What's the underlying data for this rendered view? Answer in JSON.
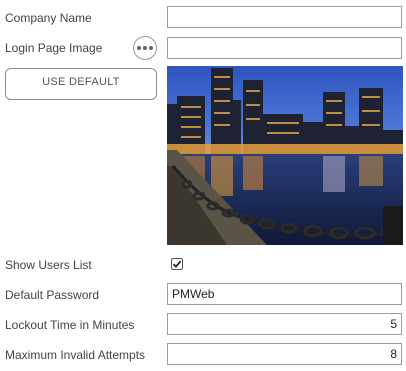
{
  "fields": {
    "company_name": {
      "label": "Company Name",
      "value": ""
    },
    "login_page_image": {
      "label": "Login Page Image",
      "value": ""
    },
    "show_users_list": {
      "label": "Show Users List",
      "checked": true
    },
    "default_password": {
      "label": "Default Password",
      "value": "PMWeb"
    },
    "lockout_time": {
      "label": "Lockout Time in Minutes",
      "value": "5"
    },
    "max_invalid_attempts": {
      "label": "Maximum Invalid Attempts",
      "value": "8"
    }
  },
  "buttons": {
    "use_default": "USE DEFAULT",
    "browse_icon": "more-horizontal-icon"
  },
  "preview": {
    "subject": "city-skyline-night-waterfront-image"
  },
  "colors": {
    "border": "#9c9c9c",
    "label_text": "#444444",
    "sky": "#3c62c4",
    "water": "#1b2a5a",
    "city_lights": "#f2b44a"
  }
}
